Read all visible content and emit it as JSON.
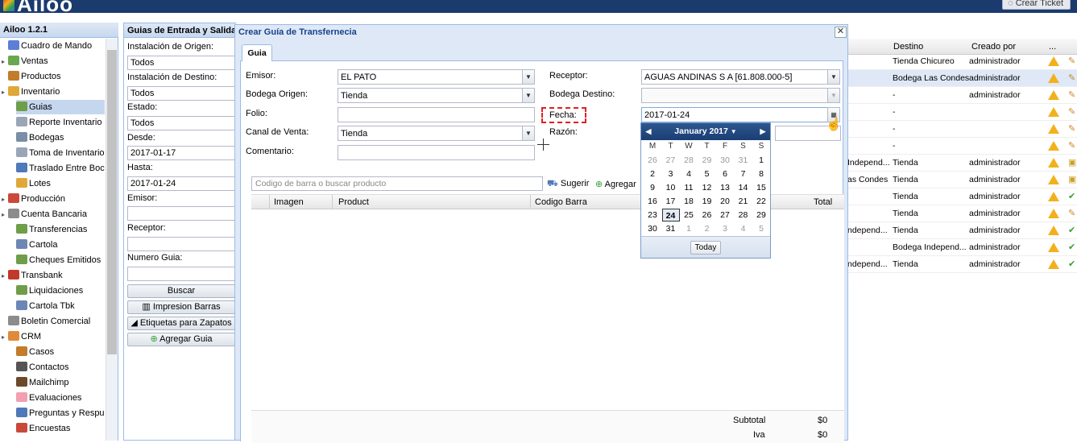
{
  "app": {
    "logo_text": "Ailoo",
    "version_title": "Ailoo 1.2.1",
    "ticket_button": "Crear Ticket"
  },
  "sidebar": {
    "items": [
      {
        "label": "Cuadro de Mando",
        "icon": "chart-icon",
        "color": "#5b7fd6"
      },
      {
        "label": "Ventas",
        "icon": "tag-icon",
        "color": "#6aa84f"
      },
      {
        "label": "Productos",
        "icon": "box-icon",
        "color": "#c27c2c"
      },
      {
        "label": "Inventario",
        "icon": "package-icon",
        "color": "#e0a83a"
      },
      {
        "label": "Guias",
        "icon": "document-icon",
        "color": "#6f9e4a"
      },
      {
        "label": "Reporte Inventario",
        "icon": "report-icon",
        "color": "#9aa6b8"
      },
      {
        "label": "Bodegas",
        "icon": "warehouse-icon",
        "color": "#7a8ea8"
      },
      {
        "label": "Toma de Inventario",
        "icon": "list-icon",
        "color": "#9aa6b8"
      },
      {
        "label": "Traslado Entre Boc",
        "icon": "truck-icon",
        "color": "#4f79b8"
      },
      {
        "label": "Lotes",
        "icon": "cube-icon",
        "color": "#e0a83a"
      },
      {
        "label": "Producción",
        "icon": "factory-icon",
        "color": "#c94a3b"
      },
      {
        "label": "Cuenta Bancaria",
        "icon": "bank-icon",
        "color": "#8c8c8c"
      },
      {
        "label": "Transferencias",
        "icon": "transfer-icon",
        "color": "#6f9e4a"
      },
      {
        "label": "Cartola",
        "icon": "grid-icon",
        "color": "#6d87b5"
      },
      {
        "label": "Cheques Emitidos",
        "icon": "check-icon",
        "color": "#6f9e4a"
      },
      {
        "label": "Transbank",
        "icon": "transbank-icon",
        "color": "#c0392b"
      },
      {
        "label": "Liquidaciones",
        "icon": "document-icon",
        "color": "#6f9e4a"
      },
      {
        "label": "Cartola Tbk",
        "icon": "grid-icon",
        "color": "#6d87b5"
      },
      {
        "label": "Boletin Comercial",
        "icon": "tag-icon",
        "color": "#8c8c8c"
      },
      {
        "label": "CRM",
        "icon": "people-icon",
        "color": "#e08a3a"
      },
      {
        "label": "Casos",
        "icon": "briefcase-icon",
        "color": "#c27c2c"
      },
      {
        "label": "Contactos",
        "icon": "contacts-icon",
        "color": "#555"
      },
      {
        "label": "Mailchimp",
        "icon": "mailchimp-icon",
        "color": "#6b4a2c"
      },
      {
        "label": "Evaluaciones",
        "icon": "eraser-icon",
        "color": "#f0a0b0"
      },
      {
        "label": "Preguntas y Respu",
        "icon": "question-icon",
        "color": "#4f79b8"
      },
      {
        "label": "Encuestas",
        "icon": "survey-icon",
        "color": "#c94a3b"
      }
    ]
  },
  "filter": {
    "title": "Guias de Entrada y Salida",
    "origin_label": "Instalación de Origen:",
    "origin_value": "Todos",
    "dest_label": "Instalación de Destino:",
    "dest_value": "Todos",
    "state_label": "Estado:",
    "state_value": "Todos",
    "from_label": "Desde:",
    "from_value": "2017-01-17",
    "to_label": "Hasta:",
    "to_value": "2017-01-24",
    "emisor_label": "Emisor:",
    "receptor_label": "Receptor:",
    "numero_label": "Numero Guia:",
    "buscar": "Buscar",
    "impresion": "Impresion Barras",
    "etiquetas": "Etiquetas para Zapatos",
    "agregar": "Agregar Guia"
  },
  "grid": {
    "headers": {
      "destino": "Destino",
      "creado": "Creado por",
      "more": "..."
    },
    "rows": [
      {
        "origen": "",
        "destino": "Tienda Chicureo",
        "creado": "administrador",
        "status": "edit"
      },
      {
        "origen": "",
        "destino": "Bodega Las Condes",
        "creado": "administrador",
        "status": "edit"
      },
      {
        "origen": "",
        "destino": "-",
        "creado": "administrador",
        "status": "edit"
      },
      {
        "origen": "",
        "destino": "-",
        "creado": "",
        "status": "edit"
      },
      {
        "origen": "",
        "destino": "-",
        "creado": "",
        "status": "edit"
      },
      {
        "origen": "",
        "destino": "-",
        "creado": "",
        "status": "edit"
      },
      {
        "origen": "Independ...",
        "destino": "Tienda",
        "creado": "administrador",
        "status": "lock"
      },
      {
        "origen": "as Condes",
        "destino": "Tienda",
        "creado": "administrador",
        "status": "lock"
      },
      {
        "origen": "",
        "destino": "Tienda",
        "creado": "administrador",
        "status": "ok"
      },
      {
        "origen": "",
        "destino": "Tienda",
        "creado": "administrador",
        "status": "edit"
      },
      {
        "origen": "ndepend...",
        "destino": "Tienda",
        "creado": "administrador",
        "status": "ok"
      },
      {
        "origen": "",
        "destino": "Bodega Independ...",
        "creado": "administrador",
        "status": "ok"
      },
      {
        "origen": "ndepend...",
        "destino": "Tienda",
        "creado": "administrador",
        "status": "ok"
      }
    ]
  },
  "dialog": {
    "title": "Crear Guía de Transfernecia",
    "tab": "Guia",
    "emisor_label": "Emisor:",
    "emisor_value": "EL PATO",
    "bodega_origen_label": "Bodega Origen:",
    "bodega_origen_value": "Tienda",
    "folio_label": "Folio:",
    "canal_label": "Canal de Venta:",
    "canal_value": "Tienda",
    "comentario_label": "Comentario:",
    "receptor_label": "Receptor:",
    "receptor_value": "AGUAS ANDINAS S A [61.808.000-5]",
    "bodega_destino_label": "Bodega Destino:",
    "fecha_label": "Fecha:",
    "fecha_value": "2017-01-24",
    "razon_label": "Razón:",
    "search_placeholder": "Codigo de barra o buscar producto",
    "sugerir": "Sugerir",
    "agregar": "Agregar",
    "columns": {
      "imagen": "Imagen",
      "product": "Product",
      "codigo": "Codigo Barra",
      "total": "Total"
    },
    "subtotal_label": "Subtotal",
    "subtotal_value": "$0",
    "iva_label": "Iva",
    "iva_value": "$0"
  },
  "calendar": {
    "month_label": "January 2017",
    "dows": [
      "M",
      "T",
      "W",
      "T",
      "F",
      "S",
      "S"
    ],
    "weeks": [
      [
        [
          "26",
          true
        ],
        [
          "27",
          true
        ],
        [
          "28",
          true
        ],
        [
          "29",
          true
        ],
        [
          "30",
          true
        ],
        [
          "31",
          true
        ],
        [
          "1",
          false
        ]
      ],
      [
        [
          "2",
          false
        ],
        [
          "3",
          false
        ],
        [
          "4",
          false
        ],
        [
          "5",
          false
        ],
        [
          "6",
          false
        ],
        [
          "7",
          false
        ],
        [
          "8",
          false
        ]
      ],
      [
        [
          "9",
          false
        ],
        [
          "10",
          false
        ],
        [
          "11",
          false
        ],
        [
          "12",
          false
        ],
        [
          "13",
          false
        ],
        [
          "14",
          false
        ],
        [
          "15",
          false
        ]
      ],
      [
        [
          "16",
          false
        ],
        [
          "17",
          false
        ],
        [
          "18",
          false
        ],
        [
          "19",
          false
        ],
        [
          "20",
          false
        ],
        [
          "21",
          false
        ],
        [
          "22",
          false
        ]
      ],
      [
        [
          "23",
          false
        ],
        [
          "24",
          false
        ],
        [
          "25",
          false
        ],
        [
          "26",
          false
        ],
        [
          "27",
          false
        ],
        [
          "28",
          false
        ],
        [
          "29",
          false
        ]
      ],
      [
        [
          "30",
          false
        ],
        [
          "31",
          false
        ],
        [
          "1",
          true
        ],
        [
          "2",
          true
        ],
        [
          "3",
          true
        ],
        [
          "4",
          true
        ],
        [
          "5",
          true
        ]
      ]
    ],
    "selected": "24",
    "today_button": "Today"
  },
  "colors": {
    "header": "#1b3a6e",
    "panel": "#dfe8f6",
    "selection": "#c5d7ef"
  }
}
